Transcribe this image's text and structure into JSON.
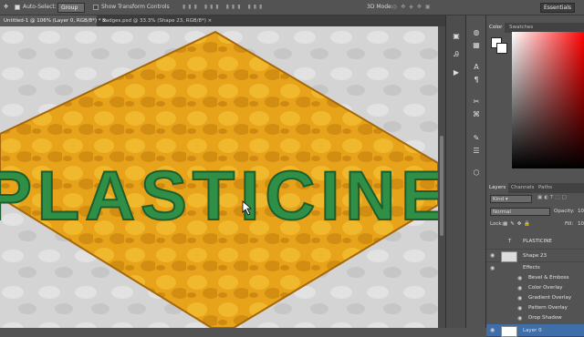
{
  "options_bar": {
    "auto_select_label": "Auto-Select:",
    "auto_select_mode": "Group",
    "show_transform_label": "Show Transform Controls",
    "mode_3d_label": "3D Mode:",
    "workspace": "Essentials"
  },
  "doc_tabs": [
    {
      "label": "Untitled-1 @ 106% (Layer 0, RGB/8*) *",
      "active": true
    },
    {
      "label": "Badges.psd @ 33.3% (Shape 23, RGB/8*)",
      "active": false
    }
  ],
  "canvas": {
    "text": "PLASTICINE",
    "colors": {
      "background": "#d9d9d9",
      "diamond": "#e8a51a",
      "text": "#2f8f46"
    }
  },
  "color_panel": {
    "tabs": [
      "Color",
      "Swatches"
    ],
    "accent": "#ff0000"
  },
  "layers_panel": {
    "tabs": [
      "Layers",
      "Channels",
      "Paths"
    ],
    "filter_kind": "Kind",
    "blend_mode": "Normal",
    "opacity_label": "Opacity:",
    "opacity_value": "10",
    "lock_label": "Lock:",
    "fill_label": "Fill:",
    "fill_value": "10",
    "layers": [
      {
        "name": "PLASTICINE",
        "kind": "T"
      },
      {
        "name": "Shape 23",
        "kind": "shape"
      },
      {
        "name": "Effects",
        "kind": "fx"
      },
      {
        "name": "Bevel & Emboss",
        "kind": "effect"
      },
      {
        "name": "Color Overlay",
        "kind": "effect"
      },
      {
        "name": "Gradient Overlay",
        "kind": "effect"
      },
      {
        "name": "Pattern Overlay",
        "kind": "effect"
      },
      {
        "name": "Drop Shadow",
        "kind": "effect"
      },
      {
        "name": "Layer 0",
        "kind": "pixel",
        "selected": true
      }
    ]
  },
  "icons": [
    "move-tool-icon",
    "brush-icon",
    "type-icon",
    "paragraph-icon",
    "play-icon",
    "eye-icon"
  ]
}
